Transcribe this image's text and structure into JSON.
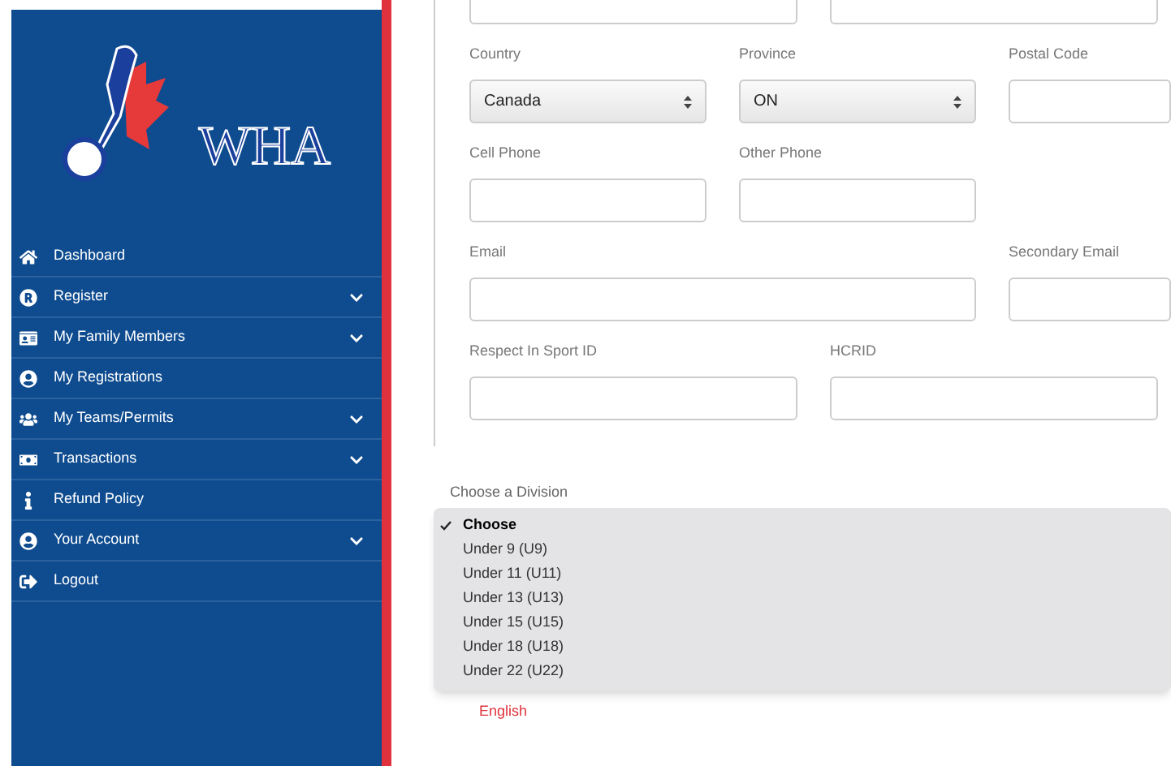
{
  "logo": {
    "text": "WHA"
  },
  "menu": [
    {
      "label": "Dashboard",
      "expandable": false
    },
    {
      "label": "Register",
      "expandable": true
    },
    {
      "label": "My Family Members",
      "expandable": true
    },
    {
      "label": "My Registrations",
      "expandable": false
    },
    {
      "label": "My Teams/Permits",
      "expandable": true
    },
    {
      "label": "Transactions",
      "expandable": true
    },
    {
      "label": "Refund Policy",
      "expandable": false
    },
    {
      "label": "Your Account",
      "expandable": true
    },
    {
      "label": "Logout",
      "expandable": false
    }
  ],
  "form_rows": [
    {
      "fields": [
        {
          "kind": "input"
        },
        {
          "kind": "input"
        }
      ]
    },
    {
      "fields": [
        {
          "kind": "select",
          "label": "Country",
          "value": "Canada"
        },
        {
          "kind": "select",
          "label": "Province",
          "value": "ON"
        },
        {
          "kind": "input",
          "label": "Postal Code"
        }
      ]
    },
    {
      "fields": [
        {
          "kind": "input",
          "label": "Cell Phone"
        },
        {
          "kind": "input",
          "label": "Other Phone"
        }
      ]
    },
    {
      "fields": [
        {
          "kind": "input",
          "label": "Email"
        },
        {
          "kind": "input",
          "label": "Secondary Email"
        }
      ]
    },
    {
      "fields": [
        {
          "kind": "input",
          "label": "Respect In Sport ID"
        },
        {
          "kind": "input",
          "label": "HCRID"
        }
      ]
    }
  ],
  "division": {
    "label": "Choose a Division",
    "options": [
      {
        "label": "Choose",
        "selected": true
      },
      {
        "label": "Under 9 (U9)",
        "selected": false
      },
      {
        "label": "Under 11 (U11)",
        "selected": false
      },
      {
        "label": "Under 13 (U13)",
        "selected": false
      },
      {
        "label": "Under 15 (U15)",
        "selected": false
      },
      {
        "label": "Under 18 (U18)",
        "selected": false
      },
      {
        "label": "Under 22 (U22)",
        "selected": false
      }
    ]
  },
  "language_link": "English"
}
